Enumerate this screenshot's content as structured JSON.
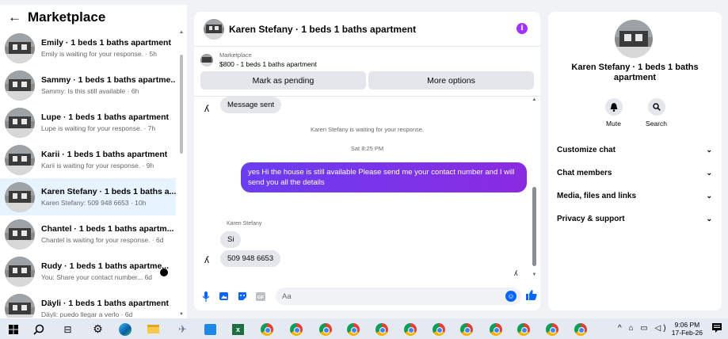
{
  "sidebar": {
    "title": "Marketplace",
    "conversations": [
      {
        "title": "Emily · 1 beds 1 baths apartment",
        "subtitle": "Emily is waiting for your response. · 5h"
      },
      {
        "title": "Sammy · 1 beds 1 baths apartme...",
        "subtitle": "Sammy: Is this still available · 6h"
      },
      {
        "title": "Lupe · 1 beds 1 baths apartment",
        "subtitle": "Lupe is waiting for your response. · 7h"
      },
      {
        "title": "Karii · 1 beds 1 baths apartment",
        "subtitle": "Karii is waiting for your response. · 9h"
      },
      {
        "title": "Karen Stefany · 1 beds 1 baths a...",
        "subtitle": "Karen Stefany: 509 948 6653 · 10h"
      },
      {
        "title": "Chantel · 1 beds 1 baths apartm...",
        "subtitle": "Chantel is waiting for your response. · 6d"
      },
      {
        "title": "Rudy · 1 beds 1 baths apartme...",
        "subtitle": "You: Share your contact number... 6d"
      },
      {
        "title": "Däyli · 1 beds 1 baths apartment",
        "subtitle": "Däyli: puedo llegar a verlo · 6d"
      }
    ]
  },
  "chat": {
    "title": "Karen Stefany · 1 beds 1 baths apartment",
    "listing": {
      "marketplace_label": "Marketplace",
      "price_line": "$800 - 1 beds 1 baths apartment",
      "mark_pending_label": "Mark as pending",
      "more_options_label": "More options"
    },
    "messages": {
      "sent_notice": "Message sent",
      "waiting_notice": "Karen Stefany is waiting for your response.",
      "timestamp": "Sat 8:25 PM",
      "outgoing": "yes Hi the house is still available Please send me your contact number and I will send you all the details",
      "sender_name": "Karen Stefany",
      "incoming_1": "Si",
      "incoming_2": "509 948  6653"
    },
    "composer": {
      "placeholder": "Aa"
    }
  },
  "right_panel": {
    "title": "Karen Stefany · 1 beds 1 baths apartment",
    "mute_label": "Mute",
    "search_label": "Search",
    "menu": [
      {
        "label": "Customize chat"
      },
      {
        "label": "Chat members"
      },
      {
        "label": "Media, files and links"
      },
      {
        "label": "Privacy & support"
      }
    ]
  },
  "taskbar": {
    "time": "9:06 PM",
    "date": "17-Feb-26"
  },
  "colors": {
    "accent": "#0866ff",
    "outgoing_bubble": "#7b2ff7",
    "info_icon": "#a033ff",
    "active_row": "#e7f3ff"
  }
}
